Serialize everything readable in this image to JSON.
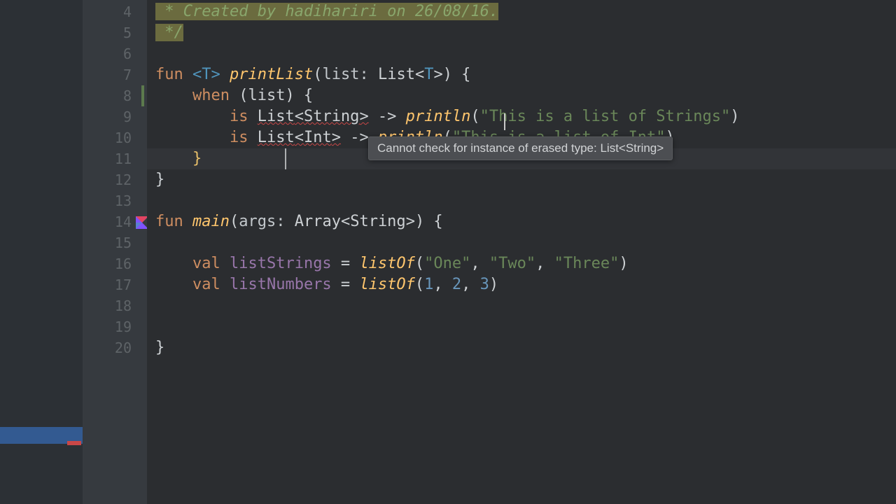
{
  "gutter": {
    "start": 4,
    "end": 20,
    "run_icon_line": 14
  },
  "tooltip": {
    "text": "Cannot check for instance of erased type: List<String>"
  },
  "code": {
    "l4_comment": " * Created by hadihariri on 26/08/16.",
    "l5_comment": " */",
    "fun": "fun",
    "generic": "<T>",
    "printList": "printList",
    "lp": "(",
    "rp": ")",
    "list_param": "list: ",
    "List": "List",
    "lt": "<",
    "gt": ">",
    "T": "T",
    "ob": " {",
    "when": "when",
    "when_arg": " (list) {",
    "is": "is",
    "String": "String",
    "arrow": " -> ",
    "println": "println",
    "str1": "\"This is a list of Strings\"",
    "Int": "Int",
    "str2": "\"This is a list of Int\"",
    "cb": "}",
    "main": "main",
    "args": "args: ",
    "Array": "Array",
    "val": "val",
    "listStrings": "listStrings",
    "listNumbers": "listNumbers",
    "eq": " = ",
    "listOf": "listOf",
    "s_one": "\"One\"",
    "s_two": "\"Two\"",
    "s_three": "\"Three\"",
    "n1": "1",
    "n2": "2",
    "n3": "3",
    "comma": ", "
  }
}
